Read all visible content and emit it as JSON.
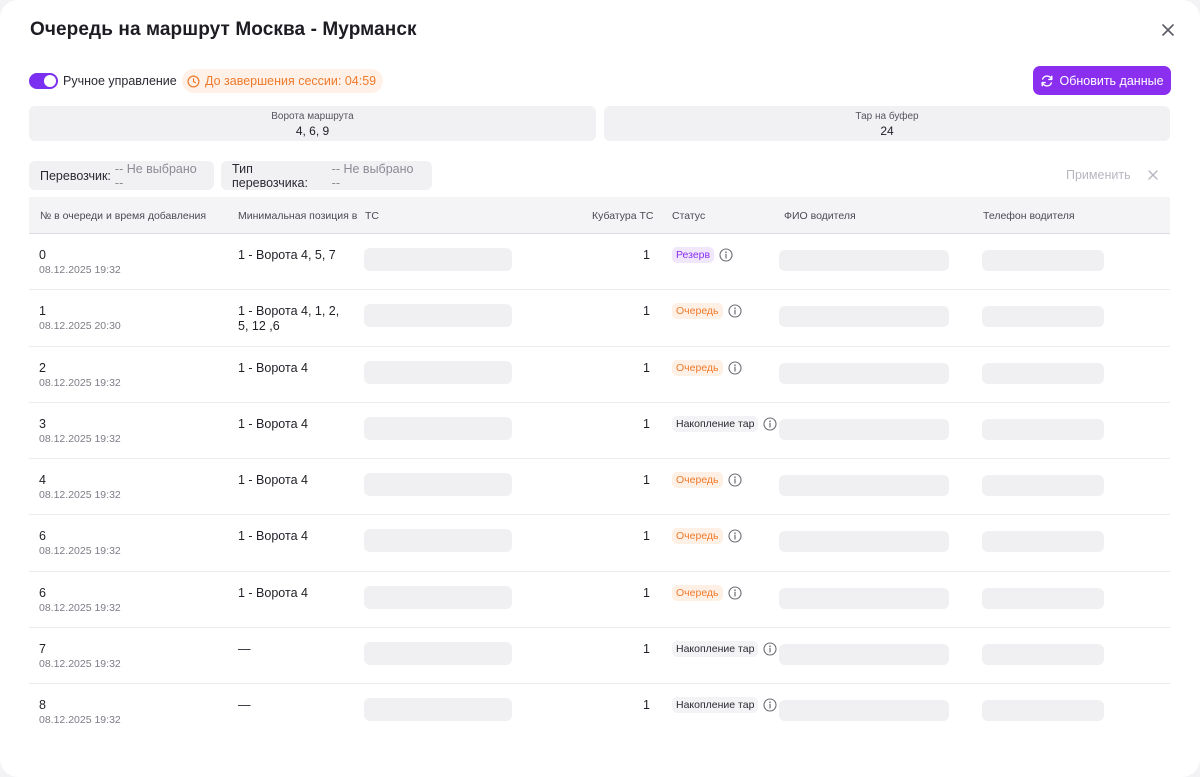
{
  "title": "Очередь на маршрут Москва - Мурманск",
  "toolbar": {
    "manual_label": "Ручное управление",
    "session_text": "До завершения сессии: 04:59",
    "refresh_label": "Обновить данные"
  },
  "info": {
    "gates_label": "Ворота маршрута",
    "gates_value": "4, 6, 9",
    "buffer_label": "Тар на буфер",
    "buffer_value": "24"
  },
  "filters": {
    "carrier_label": "Перевозчик:",
    "carrier_value": "-- Не выбрано --",
    "carrier_type_label": "Тип перевозчика:",
    "carrier_type_value": "-- Не выбрано --",
    "apply_label": "Применить"
  },
  "table": {
    "columns": [
      "№ в очереди и время добавления",
      "Минимальная позиция в",
      "ТС",
      "Кубатура ТС",
      "Статус",
      "ФИО водителя",
      "Телефон водителя"
    ],
    "rows": [
      {
        "num": "0",
        "time": "08.12.2025 19:32",
        "pos": "1 - Ворота 4, 5, 7",
        "vol": "1",
        "status": "Резерв",
        "kind": "reserve"
      },
      {
        "num": "1",
        "time": "08.12.2025 20:30",
        "pos": "1 - Ворота 4, 1, 2, 5, 12 ,6",
        "vol": "1",
        "status": "Очередь",
        "kind": "queue"
      },
      {
        "num": "2",
        "time": "08.12.2025 19:32",
        "pos": "1 - Ворота 4",
        "vol": "1",
        "status": "Очередь",
        "kind": "queue"
      },
      {
        "num": "3",
        "time": "08.12.2025 19:32",
        "pos": "1 - Ворота 4",
        "vol": "1",
        "status": "Накопление тар",
        "kind": "accum"
      },
      {
        "num": "4",
        "time": "08.12.2025 19:32",
        "pos": "1 - Ворота 4",
        "vol": "1",
        "status": "Очередь",
        "kind": "queue"
      },
      {
        "num": "6",
        "time": "08.12.2025 19:32",
        "pos": "1 - Ворота 4",
        "vol": "1",
        "status": "Очередь",
        "kind": "queue"
      },
      {
        "num": "6",
        "time": "08.12.2025 19:32",
        "pos": "1 - Ворота 4",
        "vol": "1",
        "status": "Очередь",
        "kind": "queue"
      },
      {
        "num": "7",
        "time": "08.12.2025 19:32",
        "pos": "—",
        "vol": "1",
        "status": "Накопление тар",
        "kind": "accum"
      },
      {
        "num": "8",
        "time": "08.12.2025 19:32",
        "pos": "—",
        "vol": "1",
        "status": "Накопление тар",
        "kind": "accum"
      }
    ]
  },
  "colors": {
    "accent": "#8a2ff0",
    "warning": "#ef7a2c"
  },
  "icons": {
    "close": "close-icon",
    "refresh": "refresh-icon",
    "clock": "clock-icon",
    "info": "info-icon",
    "clear": "clear-icon"
  }
}
